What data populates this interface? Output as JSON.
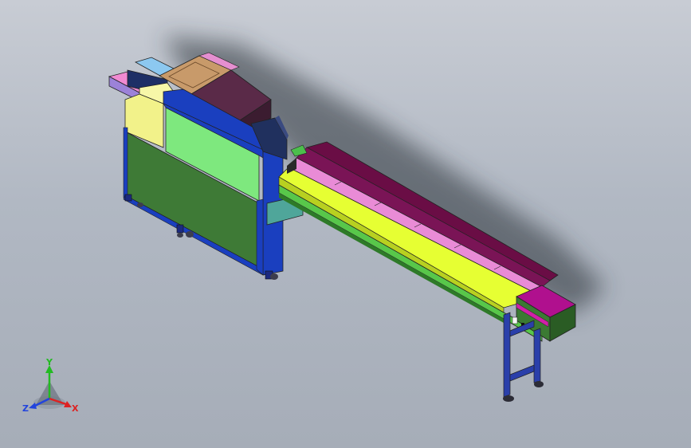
{
  "triad": {
    "y_label": "Y",
    "x_label": "X",
    "z_label": "Z",
    "y_color": "#22bb22",
    "x_color": "#dd2222",
    "z_color": "#2244dd"
  },
  "model": {
    "description_colors": {
      "frame": "#1a3fbf",
      "green_panel": "#3e7a36",
      "light_green_panel": "#7ee87e",
      "yellow": "#f4f48a",
      "conveyor_bed": "#e6ff33",
      "side_wall": "#6a0d45",
      "pink_rails": "#e98bd6",
      "top_cover": "#5a2a48",
      "tan_top": "#c89a6a",
      "end_box": "#b0108e",
      "end_box_side": "#3b7a33",
      "legs": "#2a3faa"
    }
  }
}
